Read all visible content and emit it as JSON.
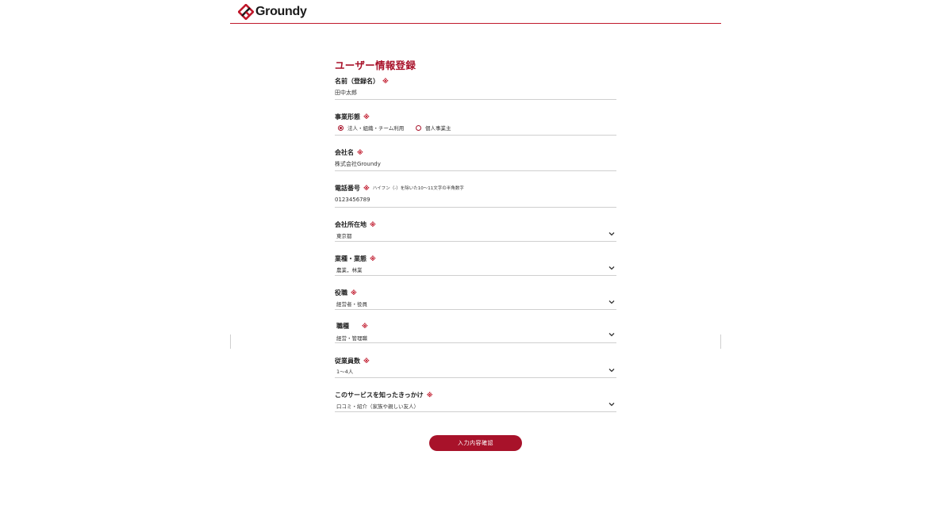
{
  "brand": {
    "name": "Groundy",
    "accent": "#a8122a"
  },
  "form": {
    "title": "ユーザー情報登録",
    "required_mark": "※",
    "fields": {
      "name": {
        "label": "名前（登録名）",
        "value": "田中太郎"
      },
      "business_type": {
        "label": "事業形態",
        "options": [
          "法人・組織・チーム利用",
          "個人事業主"
        ],
        "selected": "法人・組織・チーム利用"
      },
      "company": {
        "label": "会社名",
        "value": "株式会社Groundy"
      },
      "phone": {
        "label": "電話番号",
        "hint": "ハイフン（-）を除いた10～11文字の半角数字",
        "value": "0123456789"
      },
      "location": {
        "label": "会社所在地",
        "value": "東京都"
      },
      "industry": {
        "label": "業種・業態",
        "value": "農業，林業"
      },
      "position": {
        "label": "役職",
        "value": "経営者・役員"
      },
      "occupation": {
        "label": "職種",
        "value": "経営・管理職"
      },
      "employees": {
        "label": "従業員数",
        "value": "1〜4人"
      },
      "referral": {
        "label": "このサービスを知ったきっかけ",
        "value": "口コミ・紹介（家族や親しい友人）"
      }
    },
    "submit_label": "入力内容確認"
  },
  "icons": {
    "logo": "groundy-logo-icon",
    "dropdown": "chevron-down-icon",
    "radio": "radio-icon"
  }
}
